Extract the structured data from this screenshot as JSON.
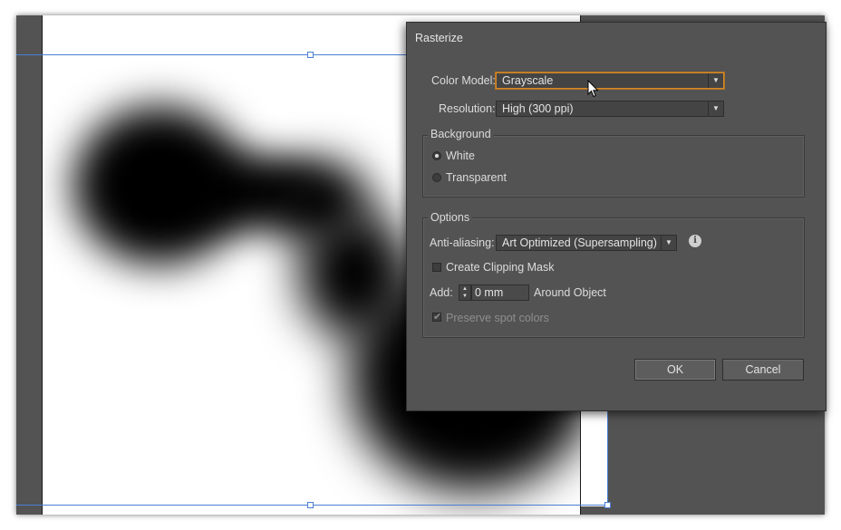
{
  "dialog": {
    "title": "Rasterize",
    "color_model": {
      "label": "Color Model:",
      "value": "Grayscale"
    },
    "resolution": {
      "label": "Resolution:",
      "value": "High (300 ppi)"
    },
    "background": {
      "title": "Background",
      "options": [
        {
          "label": "White",
          "selected": true
        },
        {
          "label": "Transparent",
          "selected": false
        }
      ]
    },
    "options": {
      "title": "Options",
      "anti_aliasing": {
        "label": "Anti-aliasing:",
        "value": "Art Optimized (Supersampling)"
      },
      "clipping_mask": {
        "label": "Create Clipping Mask",
        "checked": false
      },
      "add": {
        "label": "Add:",
        "value": "0 mm",
        "suffix": "Around Object"
      },
      "preserve_spot": {
        "label": "Preserve spot colors",
        "checked": true,
        "disabled": true
      }
    },
    "ok_label": "OK",
    "cancel_label": "Cancel"
  },
  "icons": {
    "dropdown_arrow": "▼",
    "stepper_up": "▲",
    "stepper_down": "▼",
    "info": "i",
    "check": "✔"
  },
  "colors": {
    "dialog_bg": "#535353",
    "focus_ring": "#d08a2c",
    "selection": "#4a7fd4"
  }
}
